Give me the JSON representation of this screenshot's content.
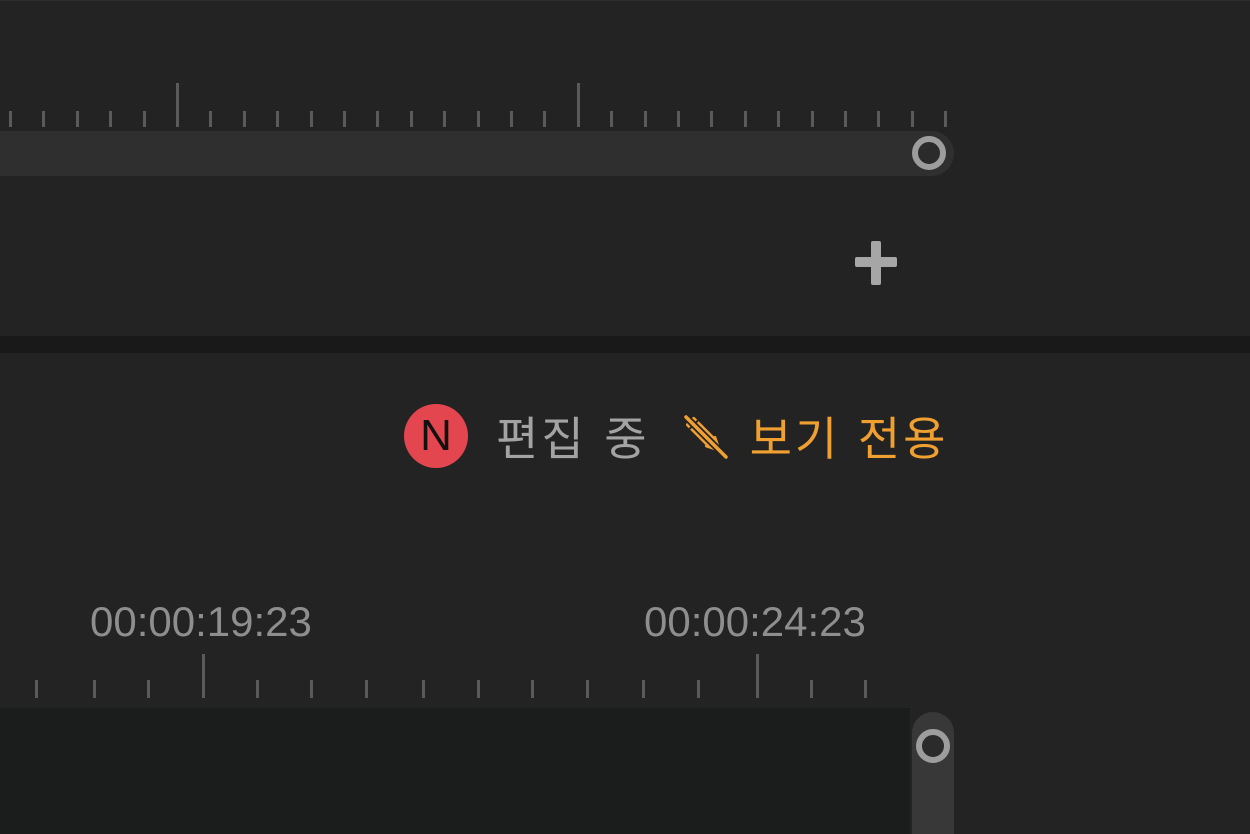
{
  "status": {
    "avatar_letter": "N",
    "editing_label": "편집 중",
    "readonly_label": "보기 전용"
  },
  "timeline": {
    "timecodes": [
      "00:00:19:23",
      "00:00:24:23"
    ]
  },
  "icons": {
    "add": "plus-icon",
    "readonly": "pencil-crossed-icon",
    "scrub_handle": "circle-handle-icon"
  },
  "colors": {
    "background": "#232323",
    "avatar": "#e3464e",
    "readonly_accent": "#f0a030",
    "muted_text": "#a3a3a3"
  }
}
